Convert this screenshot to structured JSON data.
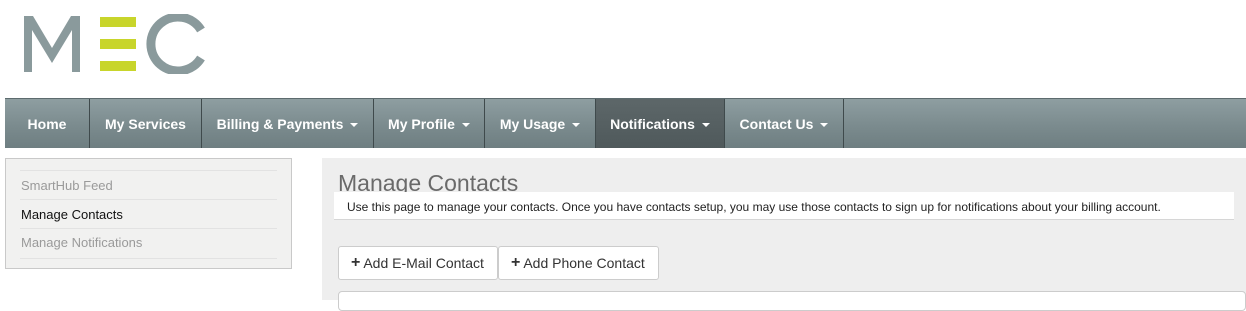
{
  "logo": {
    "text": "MEC"
  },
  "nav": {
    "items": [
      {
        "label": "Home",
        "dropdown": false,
        "active": false
      },
      {
        "label": "My Services",
        "dropdown": false,
        "active": false
      },
      {
        "label": "Billing & Payments",
        "dropdown": true,
        "active": false
      },
      {
        "label": "My Profile",
        "dropdown": true,
        "active": false
      },
      {
        "label": "My Usage",
        "dropdown": true,
        "active": false
      },
      {
        "label": "Notifications",
        "dropdown": true,
        "active": true
      },
      {
        "label": "Contact Us",
        "dropdown": true,
        "active": false
      }
    ]
  },
  "sidebar": {
    "items": [
      {
        "label": "SmartHub Feed",
        "active": false
      },
      {
        "label": "Manage Contacts",
        "active": true
      },
      {
        "label": "Manage Notifications",
        "active": false
      }
    ]
  },
  "main": {
    "title": "Manage Contacts",
    "intro": "Use this page to manage your contacts. Once you have contacts setup, you may use those contacts to sign up for notifications about your billing account.",
    "buttons": {
      "add_email": "Add E-Mail Contact",
      "add_phone": "Add Phone Contact"
    }
  },
  "colors": {
    "logo_gray": "#8a9a9c",
    "logo_green": "#c8d52b",
    "nav_bg": "#7b8b8e",
    "nav_active": "#555f61"
  }
}
